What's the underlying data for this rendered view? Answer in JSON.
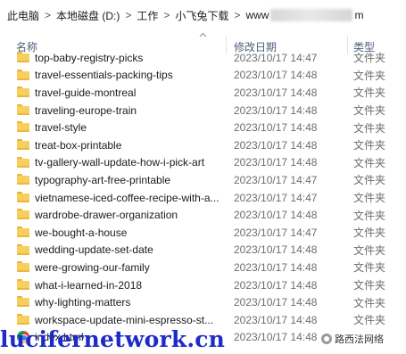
{
  "breadcrumb": {
    "items": [
      "此电脑",
      "本地磁盘 (D:)",
      "工作",
      "小飞兔下载",
      "www",
      "m"
    ],
    "separator": ">"
  },
  "columns": {
    "name": "名称",
    "date": "修改日期",
    "type": "类型"
  },
  "files": [
    {
      "name": "top-baby-registry-picks",
      "date": "2023/10/17 14:47",
      "type": "文件夹",
      "kind": "folder"
    },
    {
      "name": "travel-essentials-packing-tips",
      "date": "2023/10/17 14:48",
      "type": "文件夹",
      "kind": "folder"
    },
    {
      "name": "travel-guide-montreal",
      "date": "2023/10/17 14:48",
      "type": "文件夹",
      "kind": "folder"
    },
    {
      "name": "traveling-europe-train",
      "date": "2023/10/17 14:48",
      "type": "文件夹",
      "kind": "folder"
    },
    {
      "name": "travel-style",
      "date": "2023/10/17 14:48",
      "type": "文件夹",
      "kind": "folder"
    },
    {
      "name": "treat-box-printable",
      "date": "2023/10/17 14:48",
      "type": "文件夹",
      "kind": "folder"
    },
    {
      "name": "tv-gallery-wall-update-how-i-pick-art",
      "date": "2023/10/17 14:48",
      "type": "文件夹",
      "kind": "folder"
    },
    {
      "name": "typography-art-free-printable",
      "date": "2023/10/17 14:47",
      "type": "文件夹",
      "kind": "folder"
    },
    {
      "name": "vietnamese-iced-coffee-recipe-with-a...",
      "date": "2023/10/17 14:47",
      "type": "文件夹",
      "kind": "folder"
    },
    {
      "name": "wardrobe-drawer-organization",
      "date": "2023/10/17 14:48",
      "type": "文件夹",
      "kind": "folder"
    },
    {
      "name": "we-bought-a-house",
      "date": "2023/10/17 14:47",
      "type": "文件夹",
      "kind": "folder"
    },
    {
      "name": "wedding-update-set-date",
      "date": "2023/10/17 14:48",
      "type": "文件夹",
      "kind": "folder"
    },
    {
      "name": "were-growing-our-family",
      "date": "2023/10/17 14:48",
      "type": "文件夹",
      "kind": "folder"
    },
    {
      "name": "what-i-learned-in-2018",
      "date": "2023/10/17 14:48",
      "type": "文件夹",
      "kind": "folder"
    },
    {
      "name": "why-lighting-matters",
      "date": "2023/10/17 14:48",
      "type": "文件夹",
      "kind": "folder"
    },
    {
      "name": "workspace-update-mini-espresso-st...",
      "date": "2023/10/17 14:48",
      "type": "文件夹",
      "kind": "folder"
    },
    {
      "name": "index.html",
      "date": "2023/10/17 14:48",
      "type": "",
      "kind": "chrome-html"
    }
  ],
  "watermark": "lucifernetwork.cn",
  "wechat_mark": "路西法网络",
  "colors": {
    "folder": "#f6cf5c",
    "header_text": "#4c607a",
    "watermark": "#1d2bc9"
  },
  "icons": {
    "folder": "folder-icon",
    "html": "chrome-icon",
    "sort": "chevron-up-icon"
  }
}
